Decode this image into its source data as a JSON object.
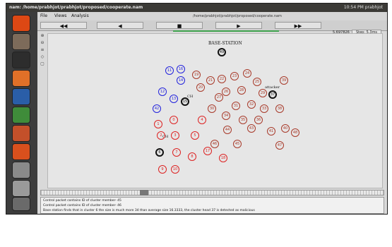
{
  "window": {
    "title": "nam: /home/prabhjot/prabhjot/proposed/cooperate.nam",
    "status": "10:54 PM  prabhjot"
  },
  "launcher": {
    "icons": [
      "ubuntu-dash-icon",
      "files-icon",
      "terminal-icon",
      "firefox-icon",
      "writer-icon",
      "calc-icon",
      "impress-icon",
      "software-center-icon",
      "settings-icon",
      "drive-icon",
      "trash-icon"
    ]
  },
  "menu": {
    "file": "File",
    "views": "Views",
    "analysis": "Analysis",
    "path": "/home/prabhjot/prabhjot/proposed/cooperate.nam"
  },
  "toolbar": {
    "rewind": "◀◀",
    "back": "◀",
    "stop": "■",
    "play": "▶",
    "fastforward": "▶▶",
    "time": "5.697826",
    "step": "Step: 5.3ms"
  },
  "sidetools": [
    "⊕",
    "⊖",
    "≡",
    "◇",
    "▢"
  ],
  "canvas": {
    "base_station_label": "BASE-STATION",
    "base_station_id": "49",
    "attacker_label": "attacker",
    "ch_label_1": "CH",
    "ch_label_2": "CH",
    "nodes": [
      {
        "id": "11",
        "color": "blue"
      },
      {
        "id": "16",
        "color": "blue"
      },
      {
        "id": "14",
        "color": "blue"
      },
      {
        "id": "12",
        "color": "blue"
      },
      {
        "id": "13",
        "color": "blue"
      },
      {
        "id": "42",
        "color": "blue"
      },
      {
        "id": "15",
        "color": "black"
      },
      {
        "id": "19",
        "color": "brown"
      },
      {
        "id": "20",
        "color": "brown"
      },
      {
        "id": "21",
        "color": "brown"
      },
      {
        "id": "22",
        "color": "brown"
      },
      {
        "id": "23",
        "color": "brown"
      },
      {
        "id": "24",
        "color": "brown"
      },
      {
        "id": "25",
        "color": "brown"
      },
      {
        "id": "26",
        "color": "brown"
      },
      {
        "id": "27",
        "color": "brown"
      },
      {
        "id": "28",
        "color": "brown"
      },
      {
        "id": "29",
        "color": "brown"
      },
      {
        "id": "30",
        "color": "brown"
      },
      {
        "id": "31",
        "color": "brown"
      },
      {
        "id": "32",
        "color": "brown"
      },
      {
        "id": "33",
        "color": "brown"
      },
      {
        "id": "34",
        "color": "brown"
      },
      {
        "id": "35",
        "color": "brown"
      },
      {
        "id": "36",
        "color": "brown"
      },
      {
        "id": "37",
        "color": "black"
      },
      {
        "id": "38",
        "color": "brown"
      },
      {
        "id": "39",
        "color": "brown"
      },
      {
        "id": "40",
        "color": "brown"
      },
      {
        "id": "41",
        "color": "brown"
      },
      {
        "id": "43",
        "color": "brown"
      },
      {
        "id": "44",
        "color": "brown"
      },
      {
        "id": "45",
        "color": "brown"
      },
      {
        "id": "46",
        "color": "brown"
      },
      {
        "id": "47",
        "color": "brown"
      },
      {
        "id": "48",
        "color": "brown"
      },
      {
        "id": "0",
        "color": "red"
      },
      {
        "id": "1",
        "color": "red"
      },
      {
        "id": "2",
        "color": "red"
      },
      {
        "id": "3",
        "color": "red"
      },
      {
        "id": "4",
        "color": "red"
      },
      {
        "id": "5",
        "color": "red"
      },
      {
        "id": "6",
        "color": "black"
      },
      {
        "id": "7",
        "color": "red"
      },
      {
        "id": "8",
        "color": "red"
      },
      {
        "id": "9",
        "color": "red"
      },
      {
        "id": "10",
        "color": "red"
      },
      {
        "id": "17",
        "color": "red"
      },
      {
        "id": "18",
        "color": "red"
      }
    ]
  },
  "console": {
    "line1": "Control packet contains ID of cluster member- 45",
    "line2": "Control packet contains ID of cluster member- 46",
    "line3": "Base station finds that in cluster 6 the size is much more 34 than average size 16.3333, the cluster head 37 is detected as malicious"
  }
}
